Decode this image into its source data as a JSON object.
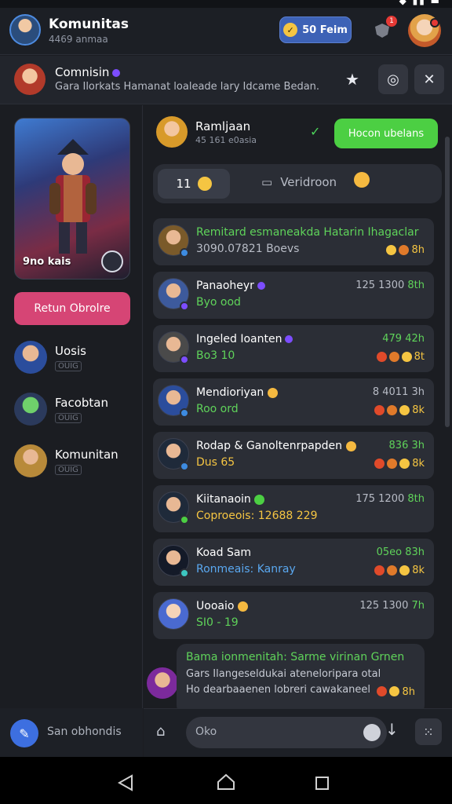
{
  "header": {
    "title": "Komunitas",
    "subtitle": "4469 anmaa",
    "coin_label": "50 Feim",
    "notif_count": "1"
  },
  "banner": {
    "title": "Comnisin",
    "subtitle": "Gara Ilorkats Hamanat loaleade lary Idcame Bedan."
  },
  "left": {
    "hero_label": "9no kais",
    "primary_button": "Retun Obrolre",
    "items": [
      {
        "name": "Uosis",
        "tag": "OUIG"
      },
      {
        "name": "Facobtan",
        "tag": "OUIG"
      },
      {
        "name": "Komunitan",
        "tag": "OUIG"
      }
    ],
    "footer_text": "San obhondis"
  },
  "right": {
    "title": "Ramljaan",
    "subtitle": "45 161 e0asia",
    "join_button": "Hocon ubelans",
    "tab_active": "11",
    "tab_other": "Veridroon",
    "rows": [
      {
        "name": "Remitard esmaneakda Hatarin Ihagaclar",
        "sub": "3090.07821 Boevs",
        "sub_color": "#b8bcc6",
        "meta": "",
        "reacts": "8h"
      },
      {
        "name": "Panaoheyr",
        "sub": "Byo ood",
        "sub_color": "#5fd35a",
        "meta": "125 1300",
        "meta2": "8th",
        "reacts": ""
      },
      {
        "name": "Ingeled Ioanten",
        "sub": "Bo3 10",
        "sub_color": "#5fd35a",
        "meta": "479 42h",
        "reacts": "8t"
      },
      {
        "name": "Mendioriyan",
        "sub": "Roo ord",
        "sub_color": "#5fd35a",
        "meta": "8 4011 3h",
        "reacts": "8k"
      },
      {
        "name": "Rodap & Ganoltenrpapden",
        "sub": "Dus 65",
        "sub_color": "#f5c542",
        "meta": "836 3h",
        "reacts": "8k"
      },
      {
        "name": "Kiitanaoin",
        "sub": "Coproeois: 12688 229",
        "sub_color": "#f5c542",
        "meta": "175 1200",
        "meta2": "8th",
        "reacts": ""
      },
      {
        "name": "Koad Sam",
        "sub": "Ronmeais: Kanray",
        "sub_color": "#5aa8f0",
        "meta": "05eo 83h",
        "reacts": "8k"
      },
      {
        "name": "Uooaio",
        "sub": "SI0 - 19",
        "sub_color": "#5fd35a",
        "meta": "125 1300",
        "meta2": "7h",
        "reacts": ""
      }
    ],
    "bubble": {
      "line1": "Bama ionmenitah: Sarme virinan Grnen",
      "line2": "Gars Ilangeseldukai ateneloripara otal",
      "line3": "Ho dearbaaenen lobreri cawakaneel",
      "react": "8h"
    },
    "composer_placeholder": "Oko"
  },
  "colors": {
    "accent_green": "#4ccf43",
    "accent_pink": "#d64575",
    "accent_blue": "#3d62b6"
  }
}
